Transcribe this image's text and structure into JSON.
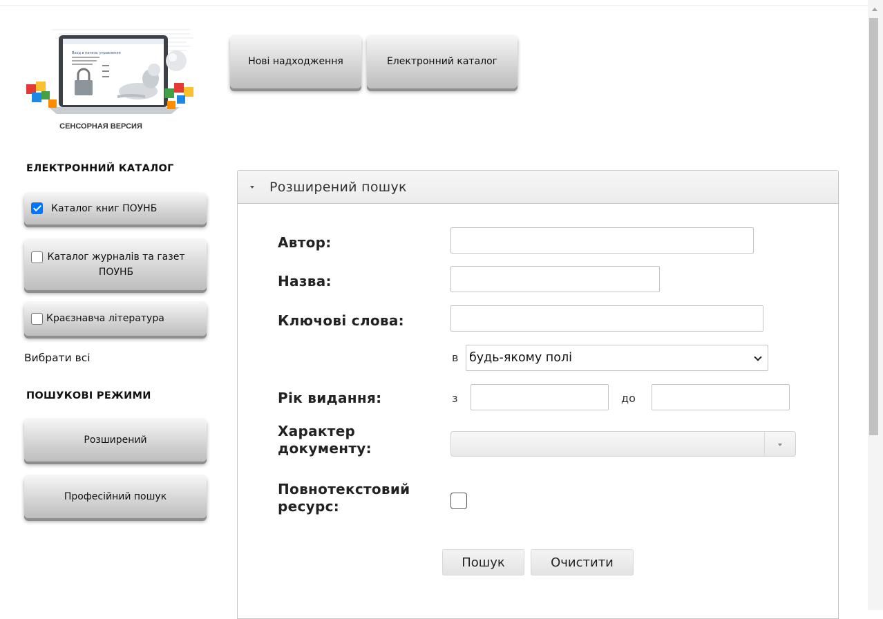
{
  "logo": {
    "caption": "СЕНСОРНАЯ ВЕРСИЯ",
    "screen_title": "Вход в панель управления"
  },
  "nav": {
    "new_arrivals": "Нові надходження",
    "catalog": "Електронний каталог"
  },
  "sidebar": {
    "catalog_title": "ЕЛЕКТРОННИЙ КАТАЛОГ",
    "catalogs": [
      {
        "label": "Каталог книг ПОУНБ",
        "checked": true
      },
      {
        "label": "Каталог журналів та газет ПОУНБ",
        "checked": false
      },
      {
        "label": "Краєзнавча література",
        "checked": false
      }
    ],
    "select_all": "Вибрати всі",
    "modes_title": "ПОШУКОВІ РЕЖИМИ",
    "modes": [
      {
        "label": "Розширений"
      },
      {
        "label": "Професійний пошук"
      }
    ]
  },
  "panel": {
    "title": "Розширений пошук",
    "fields": {
      "author_label": "Автор:",
      "author_value": "",
      "title_label": "Назва:",
      "title_value": "",
      "keywords_label": "Ключові слова:",
      "keywords_value": "",
      "in_label": "в",
      "field_select": "будь-якому полі",
      "year_label": "Рік видання:",
      "from_label": "з",
      "to_label": "до",
      "year_from": "",
      "year_to": "",
      "doc_type_label_1": "Характер",
      "doc_type_label_2": "документу:",
      "doc_type_value": "",
      "fulltext_label_1": "Повнотекстовий",
      "fulltext_label_2": "ресурс:",
      "fulltext_checked": false
    },
    "buttons": {
      "search": "Пошук",
      "clear": "Очистити"
    }
  },
  "colors": {
    "checkbox_accent": "#0075ff",
    "button_gradient_top": "#f7f7f7",
    "button_gradient_bottom": "#bdbdbd"
  }
}
